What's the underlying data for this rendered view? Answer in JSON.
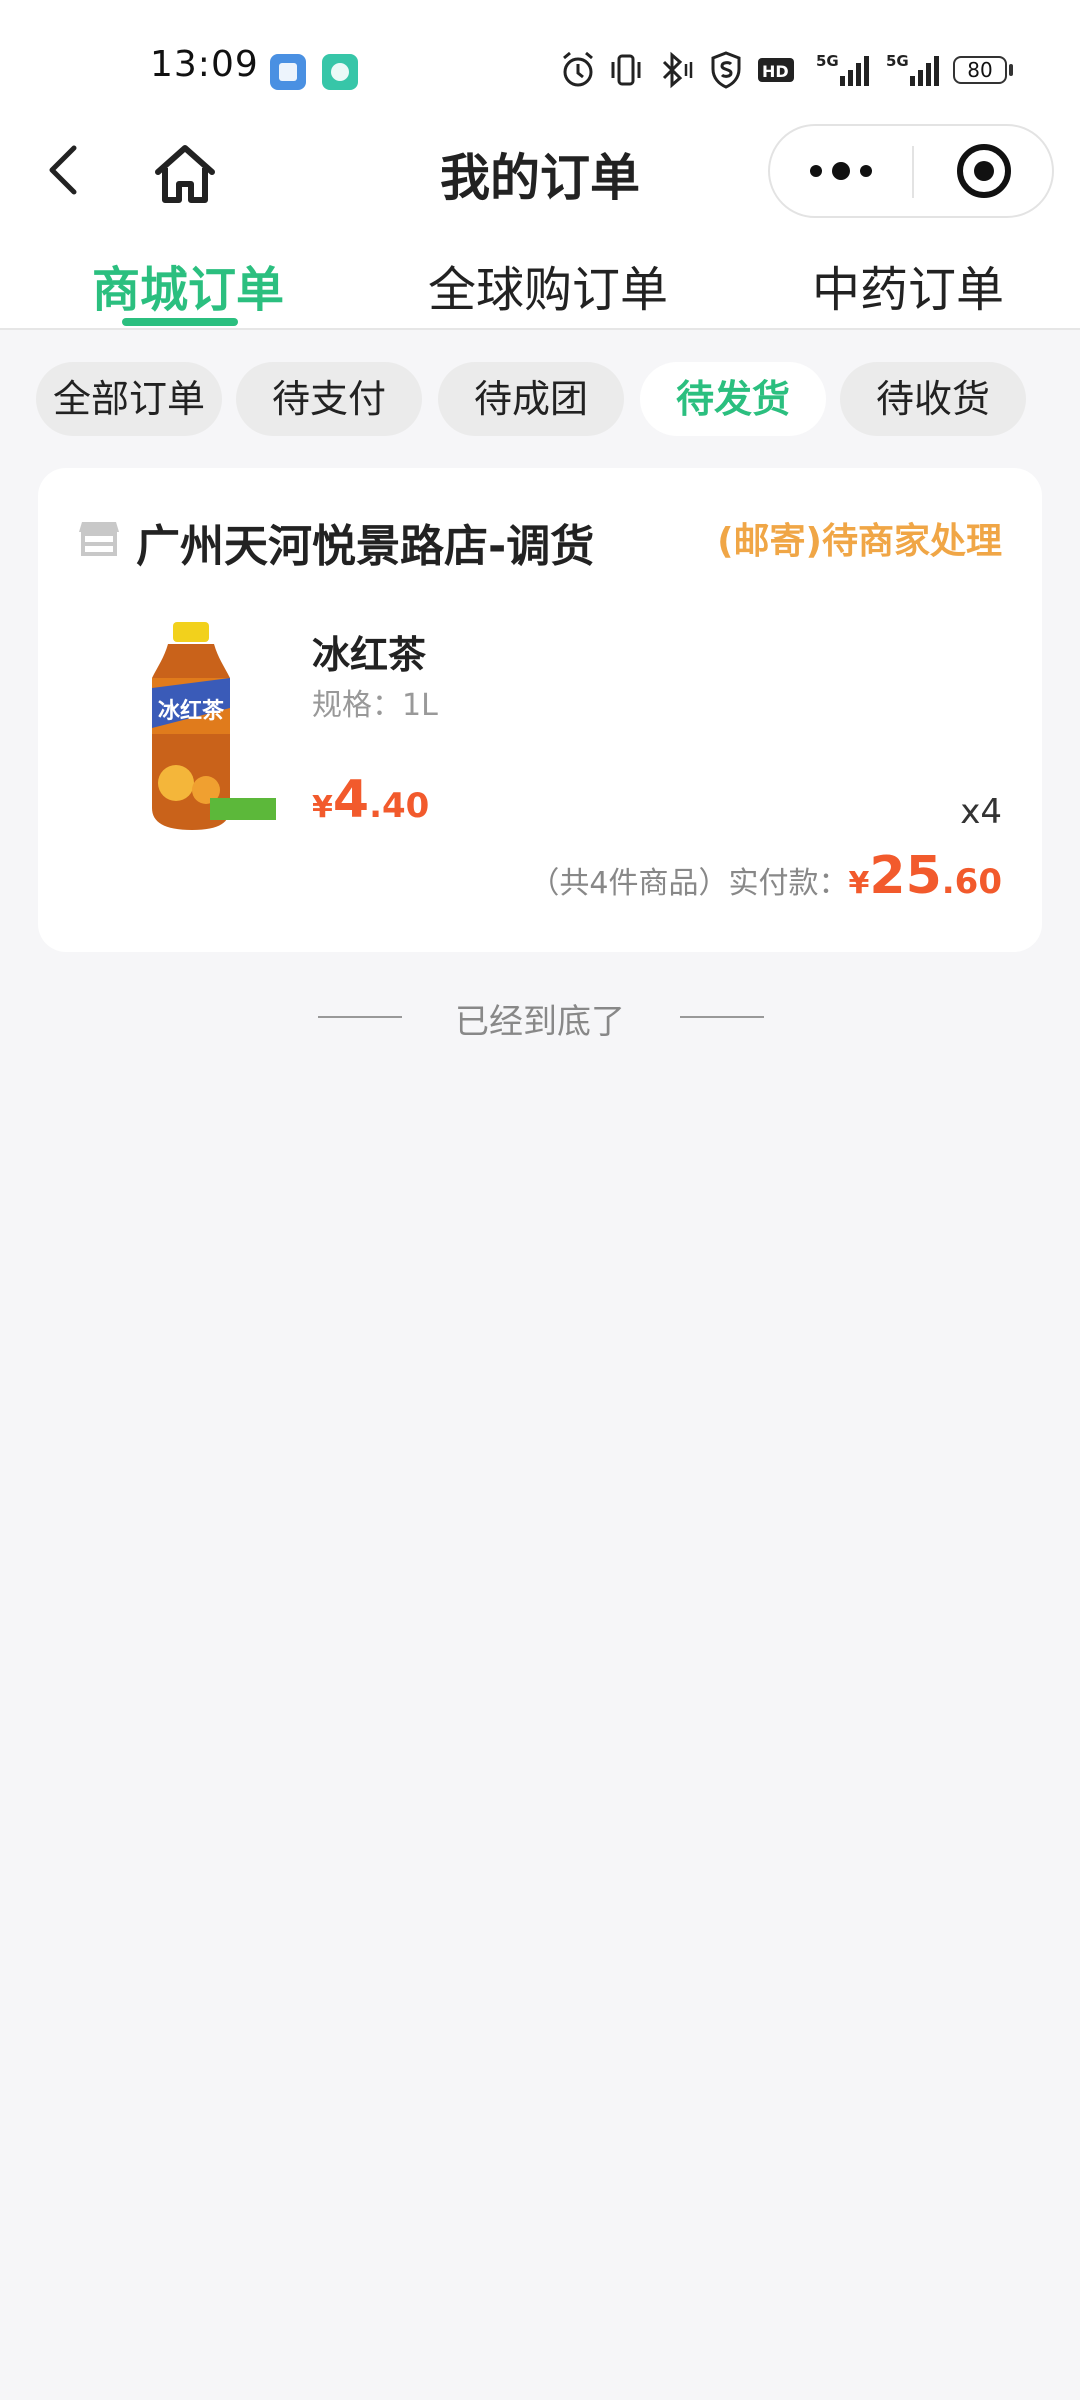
{
  "status_bar": {
    "time": "13:09",
    "battery": "80",
    "icons": [
      "alarm-icon",
      "vibrate-icon",
      "bluetooth-icon",
      "shield-icon",
      "hd-icon",
      "signal-5g-icon",
      "signal-5g-icon",
      "battery-icon"
    ]
  },
  "nav": {
    "title": "我的订单"
  },
  "tabs": [
    {
      "label": "商城订单",
      "active": true
    },
    {
      "label": "全球购订单",
      "active": false
    },
    {
      "label": "中药订单",
      "active": false
    }
  ],
  "filters": [
    {
      "label": "全部订单",
      "active": false
    },
    {
      "label": "待支付",
      "active": false
    },
    {
      "label": "待成团",
      "active": false
    },
    {
      "label": "待发货",
      "active": true
    },
    {
      "label": "待收货",
      "active": false
    }
  ],
  "order": {
    "shop_name": "广州天河悦景路店-调货",
    "status": "(邮寄)待商家处理",
    "product_name": "冰红茶",
    "product_spec": "规格：1L",
    "unit_price": {
      "currency": "¥",
      "integer": "4",
      "decimal": ".40"
    },
    "quantity": "x4",
    "total_label": "（共4件商品）实付款：",
    "total_price": {
      "currency": "¥",
      "integer": "25",
      "decimal": ".60"
    },
    "product_image_text": "冰红茶"
  },
  "footer": {
    "end_text": "已经到底了"
  },
  "colors": {
    "accent": "#2bbf7f",
    "price": "#f25a2c",
    "status": "#f0a646",
    "background": "#f6f6f8"
  }
}
